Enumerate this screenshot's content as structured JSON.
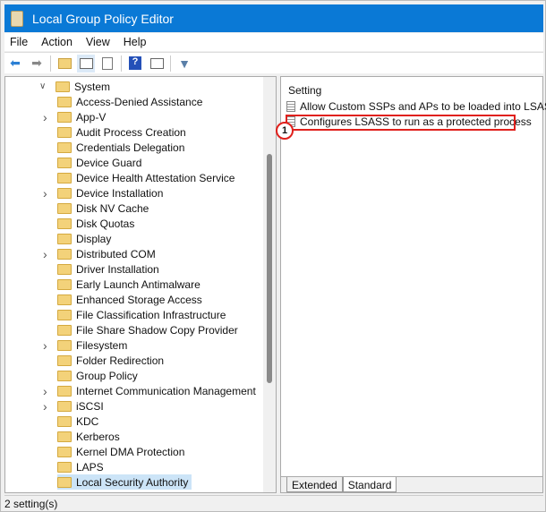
{
  "window": {
    "title": "Local Group Policy Editor"
  },
  "menu": [
    {
      "label": "File"
    },
    {
      "label": "Action"
    },
    {
      "label": "View"
    },
    {
      "label": "Help"
    }
  ],
  "toolbar": [
    {
      "icon": "back-arrow-icon"
    },
    {
      "icon": "forward-arrow-icon"
    },
    {
      "icon": "up-folder-icon"
    },
    {
      "icon": "show-hide-tree-icon"
    },
    {
      "icon": "export-list-icon"
    },
    {
      "icon": "help-icon"
    },
    {
      "icon": "show-hide-action-pane-icon"
    },
    {
      "icon": "filter-icon"
    }
  ],
  "tree": {
    "root": "System",
    "items": [
      {
        "label": "Access-Denied Assistance",
        "expandable": false
      },
      {
        "label": "App-V",
        "expandable": true
      },
      {
        "label": "Audit Process Creation",
        "expandable": false
      },
      {
        "label": "Credentials Delegation",
        "expandable": false
      },
      {
        "label": "Device Guard",
        "expandable": false
      },
      {
        "label": "Device Health Attestation Service",
        "expandable": false
      },
      {
        "label": "Device Installation",
        "expandable": true
      },
      {
        "label": "Disk NV Cache",
        "expandable": false
      },
      {
        "label": "Disk Quotas",
        "expandable": false
      },
      {
        "label": "Display",
        "expandable": false
      },
      {
        "label": "Distributed COM",
        "expandable": true
      },
      {
        "label": "Driver Installation",
        "expandable": false
      },
      {
        "label": "Early Launch Antimalware",
        "expandable": false
      },
      {
        "label": "Enhanced Storage Access",
        "expandable": false
      },
      {
        "label": "File Classification Infrastructure",
        "expandable": false
      },
      {
        "label": "File Share Shadow Copy Provider",
        "expandable": false
      },
      {
        "label": "Filesystem",
        "expandable": true
      },
      {
        "label": "Folder Redirection",
        "expandable": false
      },
      {
        "label": "Group Policy",
        "expandable": false
      },
      {
        "label": "Internet Communication Management",
        "expandable": true
      },
      {
        "label": "iSCSI",
        "expandable": true
      },
      {
        "label": "KDC",
        "expandable": false
      },
      {
        "label": "Kerberos",
        "expandable": false
      },
      {
        "label": "Kernel DMA Protection",
        "expandable": false
      },
      {
        "label": "LAPS",
        "expandable": false
      },
      {
        "label": "Local Security Authority",
        "expandable": false,
        "selected": true
      }
    ]
  },
  "settings": {
    "header": "Setting",
    "items": [
      "Allow Custom SSPs and APs to be loaded into LSASS",
      "Configures LSASS to run as a protected process"
    ],
    "callout": "1"
  },
  "tabs": [
    "Extended",
    "Standard"
  ],
  "status": "2 setting(s)"
}
